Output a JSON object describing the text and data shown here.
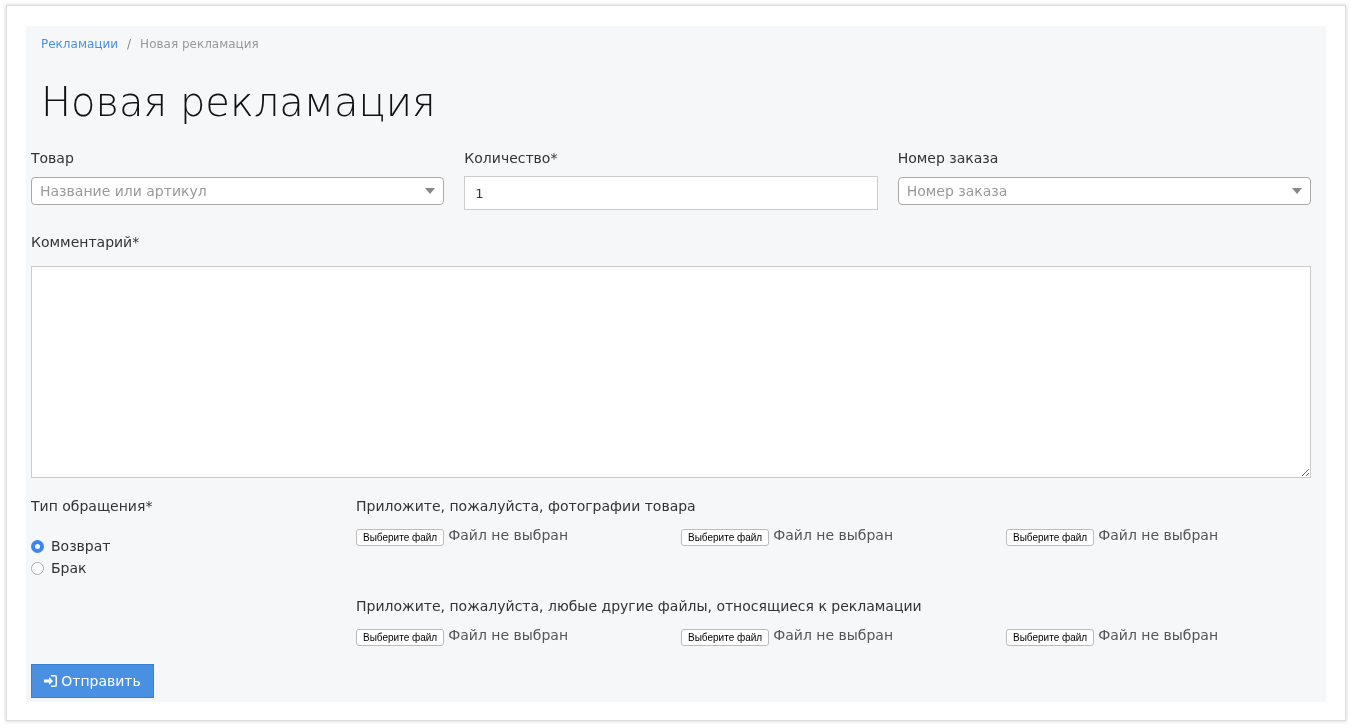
{
  "breadcrumb_separator": "/",
  "breadcrumb": [
    {
      "label": "Рекламации",
      "kind": "link"
    },
    {
      "label": "Новая рекламация",
      "kind": "current"
    }
  ],
  "title": "Новая рекламация",
  "fields": [
    {
      "label": "Товар",
      "kind": "select",
      "placeholder": "Название или артикул"
    },
    {
      "label": "Количество*",
      "kind": "input",
      "value": "1"
    },
    {
      "label": "Номер заказа",
      "kind": "select",
      "placeholder": "Номер заказа"
    }
  ],
  "comment": {
    "label": "Комментарий*"
  },
  "request_type": {
    "label": "Тип обращения*",
    "options": [
      {
        "label": "Возврат",
        "selected": true
      },
      {
        "label": "Брак",
        "selected": false
      }
    ]
  },
  "attachments": [
    {
      "label": "Приложите, пожалуйста, фотографии товара",
      "files": [
        {
          "button": "Выберите файл",
          "status": "Файл не выбран"
        },
        {
          "button": "Выберите файл",
          "status": "Файл не выбран"
        },
        {
          "button": "Выберите файл",
          "status": "Файл не выбран"
        }
      ]
    },
    {
      "label": "Приложите, пожалуйста, любые другие файлы, относящиеся к рекламации",
      "files": [
        {
          "button": "Выберите файл",
          "status": "Файл не выбран"
        },
        {
          "button": "Выберите файл",
          "status": "Файл не выбран"
        },
        {
          "button": "Выберите файл",
          "status": "Файл не выбран"
        }
      ]
    }
  ],
  "submit": "Отправить"
}
